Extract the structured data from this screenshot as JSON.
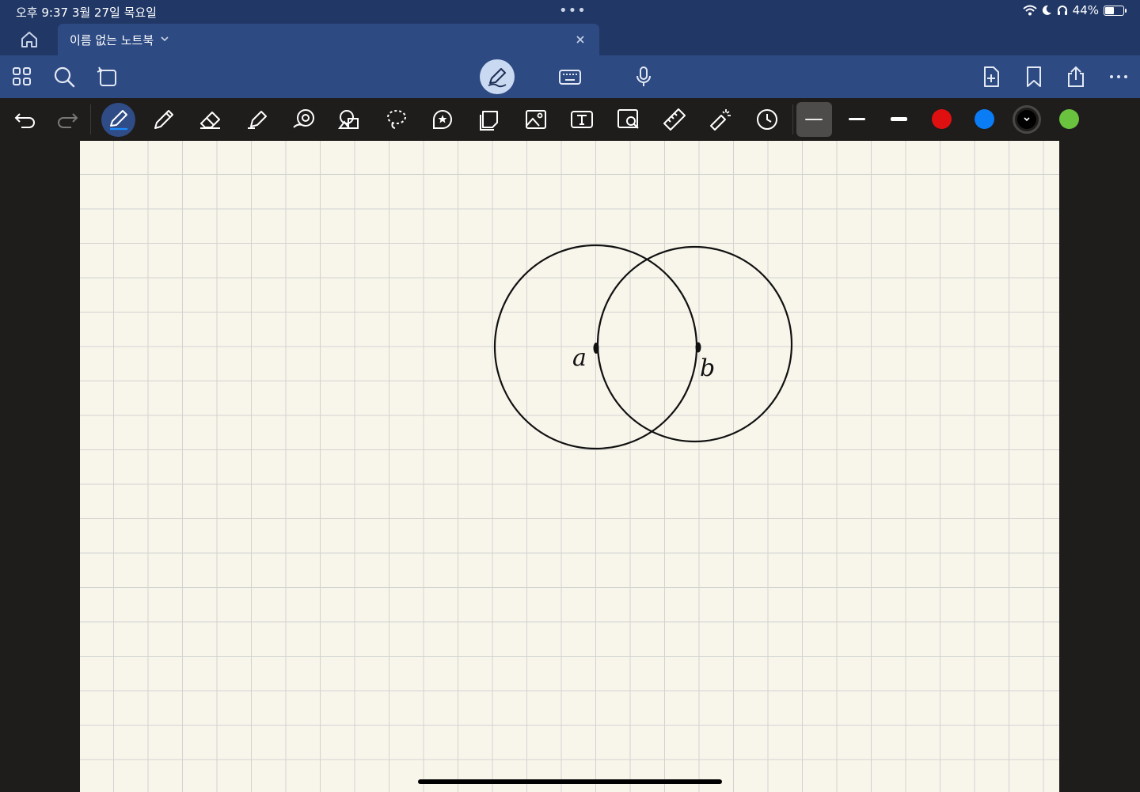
{
  "status": {
    "time": "오후 9:37   3월 27일 목요일",
    "battery": "44%",
    "battery_level": 0.44,
    "dots": "•••"
  },
  "tab": {
    "title": "이름 없는 노트북"
  },
  "main_toolbar": {
    "left_icons": [
      "grid-icon",
      "search-icon",
      "lasso-page-icon"
    ],
    "modes": [
      "pen-mode-icon",
      "keyboard-icon",
      "microphone-icon"
    ],
    "right_icons": [
      "add-page-icon",
      "bookmark-icon",
      "share-icon",
      "more-icon"
    ]
  },
  "tools": [
    "undo-icon",
    "redo-icon",
    "pen-tool-icon",
    "pencil-tool-icon",
    "eraser-tool-icon",
    "highlighter-tool-icon",
    "shape-recognizer-icon",
    "shapes-icon",
    "lasso-icon",
    "sticker-icon",
    "sticky-note-icon",
    "image-icon",
    "text-box-icon",
    "image-search-icon",
    "ruler-icon",
    "laser-pointer-icon",
    "recent-tools-icon"
  ],
  "colors": {
    "accent": "#2d4a83",
    "swatches": [
      "#e01010",
      "#0a7cf5",
      "#000000",
      "#6ac33f"
    ]
  },
  "canvas": {
    "labels": [
      "a",
      "b"
    ]
  }
}
